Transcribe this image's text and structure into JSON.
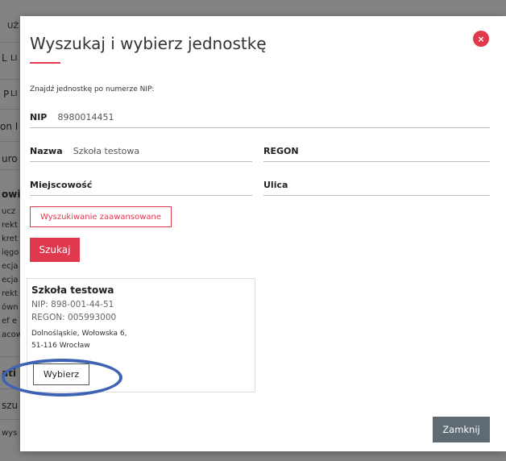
{
  "background": {
    "fragments": [
      "UŻ",
      "L",
      "LI",
      "P",
      "LI",
      "on I",
      "uro",
      "owi",
      "ucz",
      "rekt",
      "kret",
      "ięgo",
      "ecja",
      "ecja",
      "rekt",
      "ówn",
      "ef e",
      "acow",
      "ati",
      "szu",
      "wys"
    ]
  },
  "modal": {
    "title": "Wyszukaj i wybierz jednostkę",
    "close_icon": "×",
    "hint": "Znajdź jednostkę po numerze NIP:",
    "fields": {
      "nip": {
        "label": "NIP",
        "value": "8980014451"
      },
      "nazwa": {
        "label": "Nazwa",
        "value": "Szkoła testowa"
      },
      "regon": {
        "label": "REGON",
        "value": ""
      },
      "miejscowosc": {
        "label": "Miejscowość",
        "value": ""
      },
      "ulica": {
        "label": "Ulica",
        "value": ""
      }
    },
    "advanced_search_label": "Wyszukiwanie zaawansowane",
    "search_label": "Szukaj",
    "result": {
      "name": "Szkoła testowa",
      "nip": "NIP: 898-001-44-51",
      "regon": "REGON: 005993000",
      "address_line1": "Dolnośląskie, Wołowska 6,",
      "address_line2": "51-116 Wrocław",
      "choose_label": "Wybierz"
    },
    "close_button_label": "Zamknij"
  },
  "colors": {
    "accent": "#e0384d",
    "footer_button": "#5f6b73",
    "highlight": "#3f63b3"
  }
}
